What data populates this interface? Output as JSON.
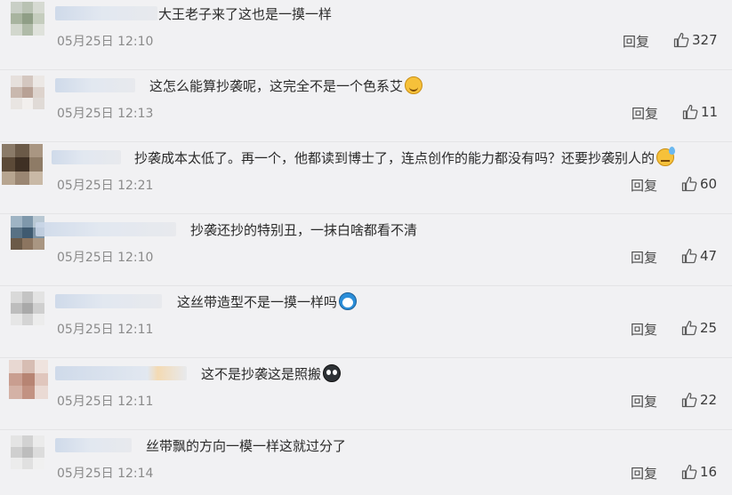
{
  "comments": [
    {
      "text": "大王老子来了这也是一摸一样",
      "emoji": "",
      "timestamp": "05月25日 12:10",
      "reply_label": "回复",
      "likes": "327"
    },
    {
      "text": "这怎么能算抄袭呢，这完全不是一个色系艾",
      "emoji": "smile",
      "timestamp": "05月25日 12:13",
      "reply_label": "回复",
      "likes": "11"
    },
    {
      "text": "抄袭成本太低了。再一个，他都读到博士了，连点创作的能力都没有吗？还要抄袭别人的",
      "emoji": "sweat",
      "timestamp": "05月25日 12:21",
      "reply_label": "回复",
      "likes": "60"
    },
    {
      "text": "抄袭还抄的特别丑，一抹白啥都看不清",
      "emoji": "",
      "timestamp": "05月25日 12:10",
      "reply_label": "回复",
      "likes": "47"
    },
    {
      "text": "这丝带造型不是一摸一样吗",
      "emoji": "doraemon",
      "timestamp": "05月25日 12:11",
      "reply_label": "回复",
      "likes": "25"
    },
    {
      "text": "这不是抄袭这是照搬",
      "emoji": "dark",
      "timestamp": "05月25日 12:11",
      "reply_label": "回复",
      "likes": "22"
    },
    {
      "text": "丝带飘的方向一模一样这就过分了",
      "emoji": "",
      "timestamp": "05月25日 12:14",
      "reply_label": "回复",
      "likes": "16"
    }
  ]
}
